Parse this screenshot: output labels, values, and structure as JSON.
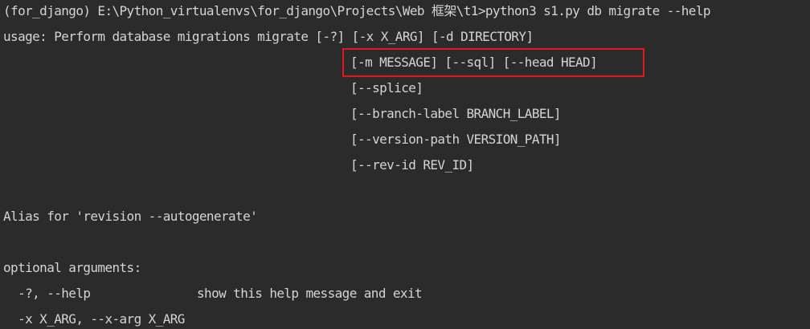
{
  "terminal": {
    "command_line": "(for_django) E:\\Python_virtualenvs\\for_django\\Projects\\Web 框架\\t1>python3 s1.py db migrate --help",
    "usage_prefix": "usage: Perform database migrations migrate ",
    "usage_lines": [
      "[-?] [-x X_ARG] [-d DIRECTORY]",
      "[-m MESSAGE] [--sql] [--head HEAD]",
      "[--splice]",
      "[--branch-label BRANCH_LABEL]",
      "[--version-path VERSION_PATH]",
      "[--rev-id REV_ID]"
    ],
    "alias_line": "Alias for 'revision --autogenerate'",
    "optional_header": "optional arguments:",
    "options": [
      {
        "flag": "  -?, --help",
        "description": "show this help message and exit"
      },
      {
        "flag": "  -x X_ARG, --x-arg X_ARG",
        "description": ""
      }
    ],
    "highlight_color": "#e0191e"
  }
}
